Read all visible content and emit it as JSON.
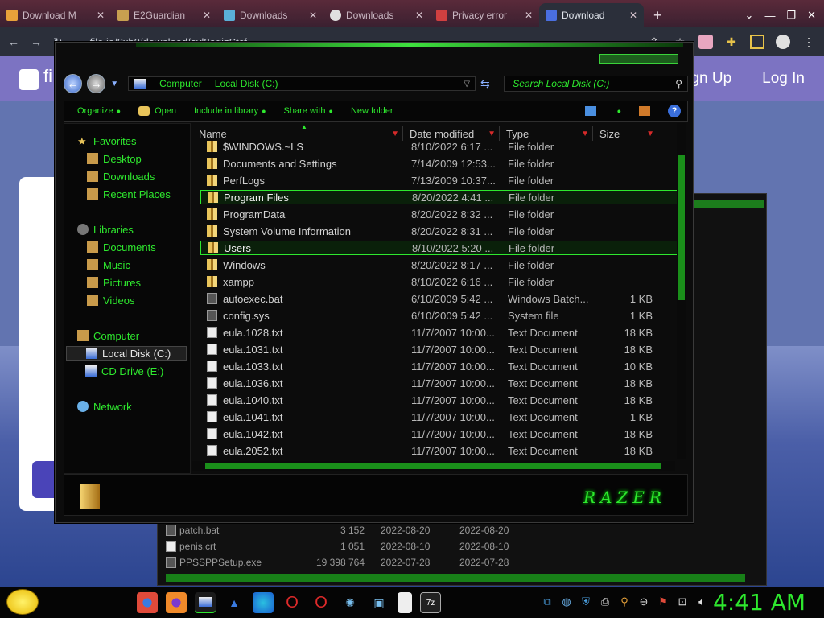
{
  "browser": {
    "tabs": [
      {
        "label": "Download M",
        "color": "#e8a23a",
        "active": false
      },
      {
        "label": "E2Guardian",
        "color": "#c8a050",
        "active": false
      },
      {
        "label": "Downloads",
        "color": "#5ab0d8",
        "active": false
      },
      {
        "label": "Downloads",
        "color": "#e0e0e0",
        "active": false
      },
      {
        "label": "Privacy error",
        "color": "#d04040",
        "active": false
      },
      {
        "label": "Download",
        "color": "#4a6fe0",
        "active": true
      }
    ],
    "url": "file.io/8xb0/download/avl8agizStcf"
  },
  "page": {
    "sign_up": "ign Up",
    "log_in": "Log In",
    "logo_text": "fi"
  },
  "explorer": {
    "breadcrumb": [
      "Computer",
      "Local Disk (C:)"
    ],
    "search_placeholder": "Search Local Disk (C:)",
    "toolbar": {
      "organize": "Organize",
      "open": "Open",
      "include": "Include in library",
      "share": "Share with",
      "new_folder": "New folder"
    },
    "nav": {
      "favorites": "Favorites",
      "desktop": "Desktop",
      "downloads": "Downloads",
      "recent": "Recent Places",
      "libraries": "Libraries",
      "documents": "Documents",
      "music": "Music",
      "pictures": "Pictures",
      "videos": "Videos",
      "computer": "Computer",
      "local_disk": "Local Disk (C:)",
      "cd_drive": "CD Drive (E:)",
      "network": "Network"
    },
    "columns": {
      "name": "Name",
      "date": "Date modified",
      "type": "Type",
      "size": "Size"
    },
    "files": [
      {
        "name": "$WINDOWS.~LS",
        "date": "8/10/2022 6:17 ...",
        "type": "File folder",
        "size": "",
        "kind": "folder",
        "selected": false
      },
      {
        "name": "Documents and Settings",
        "date": "7/14/2009 12:53...",
        "type": "File folder",
        "size": "",
        "kind": "folder",
        "selected": false
      },
      {
        "name": "PerfLogs",
        "date": "7/13/2009 10:37...",
        "type": "File folder",
        "size": "",
        "kind": "folder",
        "selected": false
      },
      {
        "name": "Program Files",
        "date": "8/20/2022 4:41 ...",
        "type": "File folder",
        "size": "",
        "kind": "folder",
        "selected": true
      },
      {
        "name": "ProgramData",
        "date": "8/20/2022 8:32 ...",
        "type": "File folder",
        "size": "",
        "kind": "folder",
        "selected": false
      },
      {
        "name": "System Volume Information",
        "date": "8/20/2022 8:31 ...",
        "type": "File folder",
        "size": "",
        "kind": "folder",
        "selected": false
      },
      {
        "name": "Users",
        "date": "8/10/2022 5:20 ...",
        "type": "File folder",
        "size": "",
        "kind": "folder",
        "selected": true
      },
      {
        "name": "Windows",
        "date": "8/20/2022 8:17 ...",
        "type": "File folder",
        "size": "",
        "kind": "folder",
        "selected": false
      },
      {
        "name": "xampp",
        "date": "8/10/2022 6:16 ...",
        "type": "File folder",
        "size": "",
        "kind": "folder",
        "selected": false
      },
      {
        "name": "autoexec.bat",
        "date": "6/10/2009 5:42 ...",
        "type": "Windows Batch...",
        "size": "1 KB",
        "kind": "bat",
        "selected": false
      },
      {
        "name": "config.sys",
        "date": "6/10/2009 5:42 ...",
        "type": "System file",
        "size": "1 KB",
        "kind": "bat",
        "selected": false
      },
      {
        "name": "eula.1028.txt",
        "date": "11/7/2007 10:00...",
        "type": "Text Document",
        "size": "18 KB",
        "kind": "doc",
        "selected": false
      },
      {
        "name": "eula.1031.txt",
        "date": "11/7/2007 10:00...",
        "type": "Text Document",
        "size": "18 KB",
        "kind": "doc",
        "selected": false
      },
      {
        "name": "eula.1033.txt",
        "date": "11/7/2007 10:00...",
        "type": "Text Document",
        "size": "10 KB",
        "kind": "doc",
        "selected": false
      },
      {
        "name": "eula.1036.txt",
        "date": "11/7/2007 10:00...",
        "type": "Text Document",
        "size": "18 KB",
        "kind": "doc",
        "selected": false
      },
      {
        "name": "eula.1040.txt",
        "date": "11/7/2007 10:00...",
        "type": "Text Document",
        "size": "18 KB",
        "kind": "doc",
        "selected": false
      },
      {
        "name": "eula.1041.txt",
        "date": "11/7/2007 10:00...",
        "type": "Text Document",
        "size": "1 KB",
        "kind": "doc",
        "selected": false
      },
      {
        "name": "eula.1042.txt",
        "date": "11/7/2007 10:00...",
        "type": "Text Document",
        "size": "18 KB",
        "kind": "doc",
        "selected": false
      },
      {
        "name": "eula.2052.txt",
        "date": "11/7/2007 10:00...",
        "type": "Text Document",
        "size": "18 KB",
        "kind": "doc",
        "selected": false
      }
    ],
    "brand": "RAZER"
  },
  "back_window": {
    "rows": [
      {
        "name": "patch.bat",
        "size": "3 152",
        "d1": "2022-08-20",
        "d2": "2022-08-20"
      },
      {
        "name": "penis.crt",
        "size": "1 051",
        "d1": "2022-08-10",
        "d2": "2022-08-10"
      },
      {
        "name": "PPSSPPSetup.exe",
        "size": "19 398 764",
        "d1": "2022-07-28",
        "d2": "2022-07-28"
      }
    ]
  },
  "taskbar": {
    "apps": [
      "chrome-icon",
      "firefox-icon",
      "explorer-icon",
      "app-icon",
      "edge-icon",
      "opera-icon",
      "opera-gx-icon",
      "settings-icon",
      "files-icon",
      "notes-icon",
      "7zip-icon"
    ],
    "clock": "4:41 AM"
  }
}
